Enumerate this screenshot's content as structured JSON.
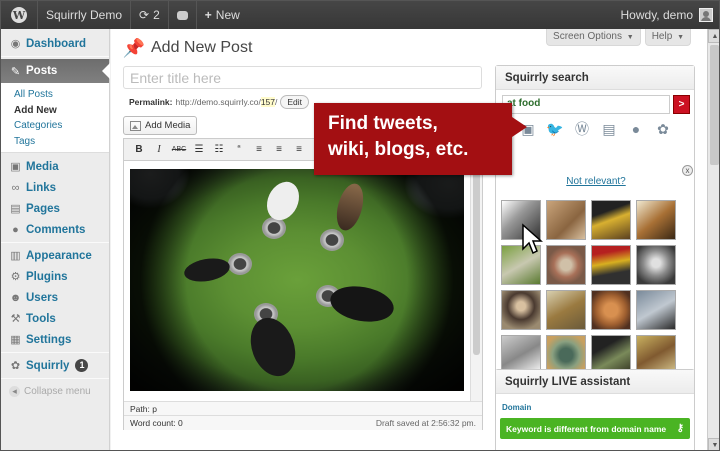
{
  "adminbar": {
    "site_name": "Squirrly Demo",
    "updates_count": "2",
    "new_label": "New",
    "howdy": "Howdy, demo"
  },
  "sidebar": {
    "items": [
      {
        "label": "Dashboard",
        "icon": "dashboard-icon"
      },
      {
        "label": "Posts",
        "icon": "pin-icon"
      },
      {
        "label": "Media",
        "icon": "media-icon"
      },
      {
        "label": "Links",
        "icon": "links-icon"
      },
      {
        "label": "Pages",
        "icon": "pages-icon"
      },
      {
        "label": "Comments",
        "icon": "comments-icon"
      },
      {
        "label": "Appearance",
        "icon": "appearance-icon"
      },
      {
        "label": "Plugins",
        "icon": "plugins-icon"
      },
      {
        "label": "Users",
        "icon": "users-icon"
      },
      {
        "label": "Tools",
        "icon": "tools-icon"
      },
      {
        "label": "Settings",
        "icon": "settings-icon"
      },
      {
        "label": "Squirrly",
        "icon": "squirrly-icon",
        "badge": "1"
      }
    ],
    "posts_submenu": [
      "All Posts",
      "Add New",
      "Categories",
      "Tags"
    ],
    "collapse_label": "Collapse menu"
  },
  "header": {
    "screen_options": "Screen Options",
    "help": "Help",
    "page_title": "Add New Post"
  },
  "editor": {
    "title_placeholder": "Enter title here",
    "permalink_label": "Permalink:",
    "permalink_base": "http://demo.squirrly.co/",
    "permalink_id": "157",
    "permalink_slash": "/",
    "edit_label": "Edit",
    "add_media": "Add Media",
    "toolbar": {
      "bold": "B",
      "italic": "I",
      "strike": "ABC",
      "quote": "“"
    },
    "path": "Path: p",
    "word_count": "Word count: 0",
    "draft_saved": "Draft saved at 2:56:32 pm."
  },
  "squirrly": {
    "title": "Squirrly search",
    "query": "at food",
    "go_label": ">",
    "not_relevant": "Not relevant?",
    "close": "x",
    "sources": [
      "images-icon",
      "twitter-icon",
      "wikipedia-icon",
      "news-icon",
      "blogs-icon",
      "squirrel-icon"
    ]
  },
  "live": {
    "title": "Squirrly LIVE assistant",
    "domain_label": "Domain",
    "domain_message": "Keyword is different from domain name"
  },
  "callout": {
    "line1": "Find tweets,",
    "line2": "wiki, blogs, etc."
  },
  "colors": {
    "callout": "#a30f12",
    "success": "#4ab423",
    "link": "#21759b"
  }
}
